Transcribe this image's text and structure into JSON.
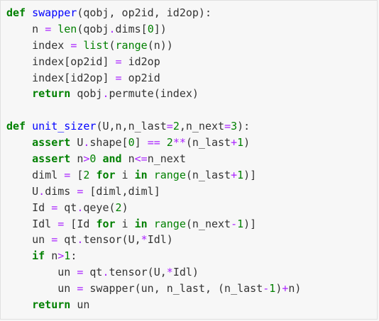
{
  "colors": {
    "background": "#f7f7f7",
    "keyword": "#008000",
    "function_name": "#0000ff",
    "builtin": "#008000",
    "operator": "#aa22ff",
    "number": "#008000",
    "text": "#333333"
  },
  "code": {
    "lines": [
      [
        {
          "t": "kw",
          "v": "def"
        },
        {
          "t": "tx",
          "v": " "
        },
        {
          "t": "fn",
          "v": "swapper"
        },
        {
          "t": "tx",
          "v": "(qobj, op2id, id2op):"
        }
      ],
      [
        {
          "t": "tx",
          "v": "    n "
        },
        {
          "t": "op",
          "v": "="
        },
        {
          "t": "tx",
          "v": " "
        },
        {
          "t": "bi",
          "v": "len"
        },
        {
          "t": "tx",
          "v": "(qobj"
        },
        {
          "t": "op",
          "v": "."
        },
        {
          "t": "tx",
          "v": "dims["
        },
        {
          "t": "num",
          "v": "0"
        },
        {
          "t": "tx",
          "v": "])"
        }
      ],
      [
        {
          "t": "tx",
          "v": "    index "
        },
        {
          "t": "op",
          "v": "="
        },
        {
          "t": "tx",
          "v": " "
        },
        {
          "t": "bi",
          "v": "list"
        },
        {
          "t": "tx",
          "v": "("
        },
        {
          "t": "bi",
          "v": "range"
        },
        {
          "t": "tx",
          "v": "(n))"
        }
      ],
      [
        {
          "t": "tx",
          "v": "    index[op2id] "
        },
        {
          "t": "op",
          "v": "="
        },
        {
          "t": "tx",
          "v": " id2op"
        }
      ],
      [
        {
          "t": "tx",
          "v": "    index[id2op] "
        },
        {
          "t": "op",
          "v": "="
        },
        {
          "t": "tx",
          "v": " op2id"
        }
      ],
      [
        {
          "t": "tx",
          "v": "    "
        },
        {
          "t": "kw",
          "v": "return"
        },
        {
          "t": "tx",
          "v": " qobj"
        },
        {
          "t": "op",
          "v": "."
        },
        {
          "t": "tx",
          "v": "permute(index)"
        }
      ],
      [],
      [
        {
          "t": "kw",
          "v": "def"
        },
        {
          "t": "tx",
          "v": " "
        },
        {
          "t": "fn",
          "v": "unit_sizer"
        },
        {
          "t": "tx",
          "v": "(U,n,n_last"
        },
        {
          "t": "op",
          "v": "="
        },
        {
          "t": "num",
          "v": "2"
        },
        {
          "t": "tx",
          "v": ",n_next"
        },
        {
          "t": "op",
          "v": "="
        },
        {
          "t": "num",
          "v": "3"
        },
        {
          "t": "tx",
          "v": "):"
        }
      ],
      [
        {
          "t": "tx",
          "v": "    "
        },
        {
          "t": "kw",
          "v": "assert"
        },
        {
          "t": "tx",
          "v": " U"
        },
        {
          "t": "op",
          "v": "."
        },
        {
          "t": "tx",
          "v": "shape["
        },
        {
          "t": "num",
          "v": "0"
        },
        {
          "t": "tx",
          "v": "] "
        },
        {
          "t": "op",
          "v": "=="
        },
        {
          "t": "tx",
          "v": " "
        },
        {
          "t": "num",
          "v": "2"
        },
        {
          "t": "op",
          "v": "**"
        },
        {
          "t": "tx",
          "v": "(n_last"
        },
        {
          "t": "op",
          "v": "+"
        },
        {
          "t": "num",
          "v": "1"
        },
        {
          "t": "tx",
          "v": ")"
        }
      ],
      [
        {
          "t": "tx",
          "v": "    "
        },
        {
          "t": "kw",
          "v": "assert"
        },
        {
          "t": "tx",
          "v": " n"
        },
        {
          "t": "op",
          "v": ">"
        },
        {
          "t": "num",
          "v": "0"
        },
        {
          "t": "tx",
          "v": " "
        },
        {
          "t": "kw",
          "v": "and"
        },
        {
          "t": "tx",
          "v": " n"
        },
        {
          "t": "op",
          "v": "<="
        },
        {
          "t": "tx",
          "v": "n_next"
        }
      ],
      [
        {
          "t": "tx",
          "v": "    diml "
        },
        {
          "t": "op",
          "v": "="
        },
        {
          "t": "tx",
          "v": " ["
        },
        {
          "t": "num",
          "v": "2"
        },
        {
          "t": "tx",
          "v": " "
        },
        {
          "t": "kw",
          "v": "for"
        },
        {
          "t": "tx",
          "v": " i "
        },
        {
          "t": "kw",
          "v": "in"
        },
        {
          "t": "tx",
          "v": " "
        },
        {
          "t": "bi",
          "v": "range"
        },
        {
          "t": "tx",
          "v": "(n_last"
        },
        {
          "t": "op",
          "v": "+"
        },
        {
          "t": "num",
          "v": "1"
        },
        {
          "t": "tx",
          "v": ")]"
        }
      ],
      [
        {
          "t": "tx",
          "v": "    U"
        },
        {
          "t": "op",
          "v": "."
        },
        {
          "t": "tx",
          "v": "dims "
        },
        {
          "t": "op",
          "v": "="
        },
        {
          "t": "tx",
          "v": " [diml,diml]"
        }
      ],
      [
        {
          "t": "tx",
          "v": "    Id "
        },
        {
          "t": "op",
          "v": "="
        },
        {
          "t": "tx",
          "v": " qt"
        },
        {
          "t": "op",
          "v": "."
        },
        {
          "t": "tx",
          "v": "qeye("
        },
        {
          "t": "num",
          "v": "2"
        },
        {
          "t": "tx",
          "v": ")"
        }
      ],
      [
        {
          "t": "tx",
          "v": "    Idl "
        },
        {
          "t": "op",
          "v": "="
        },
        {
          "t": "tx",
          "v": " [Id "
        },
        {
          "t": "kw",
          "v": "for"
        },
        {
          "t": "tx",
          "v": " i "
        },
        {
          "t": "kw",
          "v": "in"
        },
        {
          "t": "tx",
          "v": " "
        },
        {
          "t": "bi",
          "v": "range"
        },
        {
          "t": "tx",
          "v": "(n_next"
        },
        {
          "t": "op",
          "v": "-"
        },
        {
          "t": "num",
          "v": "1"
        },
        {
          "t": "tx",
          "v": ")]"
        }
      ],
      [
        {
          "t": "tx",
          "v": "    un "
        },
        {
          "t": "op",
          "v": "="
        },
        {
          "t": "tx",
          "v": " qt"
        },
        {
          "t": "op",
          "v": "."
        },
        {
          "t": "tx",
          "v": "tensor(U,"
        },
        {
          "t": "op",
          "v": "*"
        },
        {
          "t": "tx",
          "v": "Idl)"
        }
      ],
      [
        {
          "t": "tx",
          "v": "    "
        },
        {
          "t": "kw",
          "v": "if"
        },
        {
          "t": "tx",
          "v": " n"
        },
        {
          "t": "op",
          "v": ">"
        },
        {
          "t": "num",
          "v": "1"
        },
        {
          "t": "tx",
          "v": ":"
        }
      ],
      [
        {
          "t": "tx",
          "v": "        un "
        },
        {
          "t": "op",
          "v": "="
        },
        {
          "t": "tx",
          "v": " qt"
        },
        {
          "t": "op",
          "v": "."
        },
        {
          "t": "tx",
          "v": "tensor(U,"
        },
        {
          "t": "op",
          "v": "*"
        },
        {
          "t": "tx",
          "v": "Idl)"
        }
      ],
      [
        {
          "t": "tx",
          "v": "        un "
        },
        {
          "t": "op",
          "v": "="
        },
        {
          "t": "tx",
          "v": " swapper(un, n_last, (n_last"
        },
        {
          "t": "op",
          "v": "-"
        },
        {
          "t": "num",
          "v": "1"
        },
        {
          "t": "tx",
          "v": ")"
        },
        {
          "t": "op",
          "v": "+"
        },
        {
          "t": "tx",
          "v": "n)"
        }
      ],
      [
        {
          "t": "tx",
          "v": "    "
        },
        {
          "t": "kw",
          "v": "return"
        },
        {
          "t": "tx",
          "v": " un"
        }
      ]
    ]
  }
}
